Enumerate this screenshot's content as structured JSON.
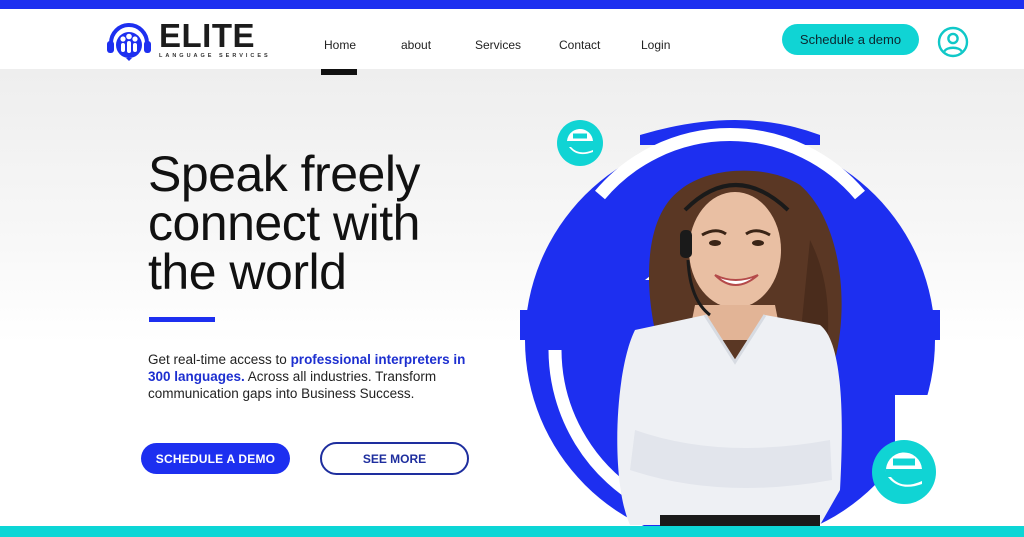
{
  "brand": {
    "name": "ELITE",
    "tagline": "LANGUAGE SERVICES",
    "primary_color": "#1d2ff0",
    "accent_color": "#10d4d4"
  },
  "nav": {
    "items": [
      {
        "label": "Home",
        "active": true
      },
      {
        "label": "about",
        "active": false
      },
      {
        "label": "Services",
        "active": false
      },
      {
        "label": "Contact",
        "active": false
      },
      {
        "label": "Login",
        "active": false
      }
    ],
    "cta_label": "Schedule a demo",
    "user_icon": "user-circle-icon"
  },
  "hero": {
    "headline": [
      "Speak freely",
      "connect with",
      "the world"
    ],
    "lead_prefix": "Get real-time access to ",
    "lead_highlight": "professional interpreters in 300 languages.",
    "lead_suffix": " Across all industries. Transform communication gaps into Business Success.",
    "primary_button": "SCHEDULE A DEMO",
    "secondary_button": "SEE MORE",
    "image_alt": "Smiling interpreter wearing a headset in front of a large blue 'e' logo"
  }
}
